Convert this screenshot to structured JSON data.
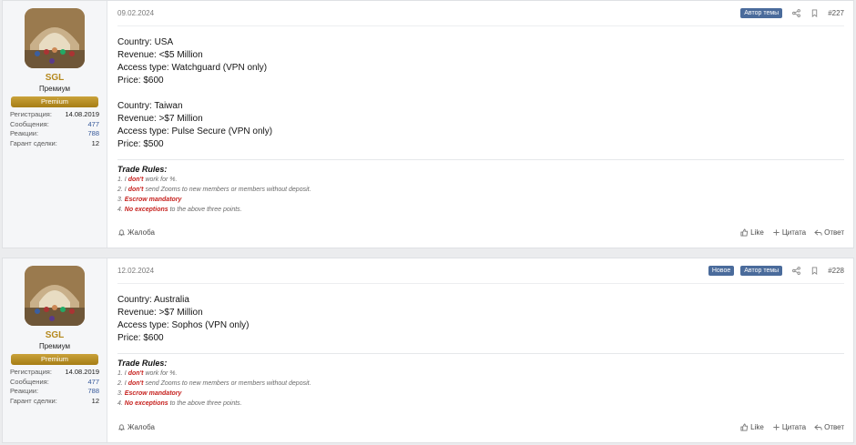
{
  "posts": [
    {
      "user": {
        "name": "SGL",
        "title": "Премиум",
        "badge": "Premium",
        "stats": [
          {
            "label": "Регистрация:",
            "value": "14.08.2019"
          },
          {
            "label": "Сообщения:",
            "value": "477"
          },
          {
            "label": "Реакции:",
            "value": "788"
          },
          {
            "label": "Гарант сделки:",
            "value": "12"
          }
        ]
      },
      "date": "09.02.2024",
      "tags": [
        "Автор темы"
      ],
      "number": "#227",
      "lines_a": [
        "Country: USA",
        "Revenue: <$5 Million",
        "Access type: Watchguard (VPN only)",
        "Price: $600"
      ],
      "lines_b": [
        "Country: Taiwan",
        "Revenue: >$7 Million",
        "Access type: Pulse Secure (VPN only)",
        "Price: $500"
      ],
      "rules": {
        "title": "Trade Rules:",
        "r1": {
          "pre": "1. I ",
          "em": "don't",
          "post": " work for %."
        },
        "r2": {
          "pre": "2. I ",
          "em": "don't",
          "post": " send Zooms to new members or members without deposit."
        },
        "r3": {
          "pre": "3. ",
          "em": "Escrow mandatory",
          "post": ""
        },
        "r4": {
          "pre": "4. ",
          "em": "No exceptions",
          "post": " to the above three points."
        }
      },
      "footer": {
        "report": "Жалоба",
        "like": "Like",
        "quote": "Цитата",
        "reply": "Ответ"
      }
    },
    {
      "user": {
        "name": "SGL",
        "title": "Премиум",
        "badge": "Premium",
        "stats": [
          {
            "label": "Регистрация:",
            "value": "14.08.2019"
          },
          {
            "label": "Сообщения:",
            "value": "477"
          },
          {
            "label": "Реакции:",
            "value": "788"
          },
          {
            "label": "Гарант сделки:",
            "value": "12"
          }
        ]
      },
      "date": "12.02.2024",
      "tags": [
        "Новое",
        "Автор темы"
      ],
      "number": "#228",
      "lines_a": [
        "Country: Australia",
        "Revenue: >$7 Million",
        "Access type: Sophos (VPN only)",
        "Price: $600"
      ],
      "rules": {
        "title": "Trade Rules:",
        "r1": {
          "pre": "1. I ",
          "em": "don't",
          "post": " work for %."
        },
        "r2": {
          "pre": "2. I ",
          "em": "don't",
          "post": " send Zooms to new members or members without deposit."
        },
        "r3": {
          "pre": "3. ",
          "em": "Escrow mandatory",
          "post": ""
        },
        "r4": {
          "pre": "4. ",
          "em": "No exceptions",
          "post": " to the above three points."
        }
      },
      "footer": {
        "report": "Жалоба",
        "like": "Like",
        "quote": "Цитата",
        "reply": "Ответ"
      }
    }
  ],
  "colors": {
    "username": "#b5891e",
    "tag": "#4a6b9b",
    "rule_emphasis": "#c6211e",
    "badge": "#b8901f"
  }
}
